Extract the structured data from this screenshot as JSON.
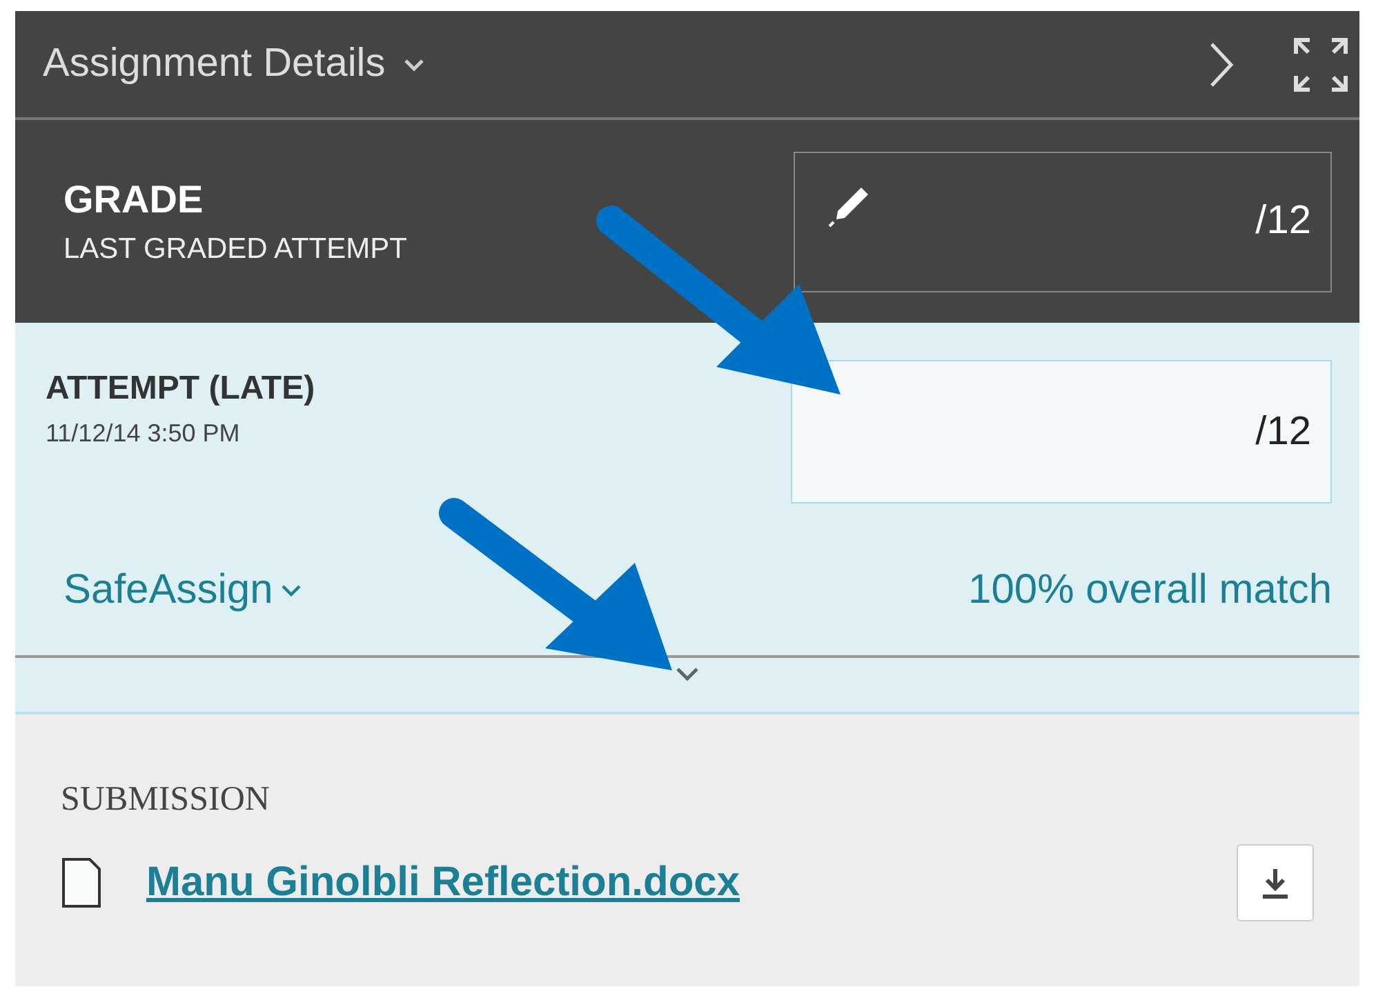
{
  "header": {
    "title": "Assignment Details"
  },
  "grade": {
    "title": "GRADE",
    "subtitle": "LAST GRADED ATTEMPT",
    "score": "/12"
  },
  "attempt": {
    "title": "ATTEMPT (LATE)",
    "date": "11/12/14 3:50 PM",
    "score": "/12"
  },
  "safeassign": {
    "label": "SafeAssign",
    "match": "100% overall match"
  },
  "submission": {
    "heading": "SUBMISSION",
    "file": "Manu Ginolbli Reflection.docx"
  }
}
